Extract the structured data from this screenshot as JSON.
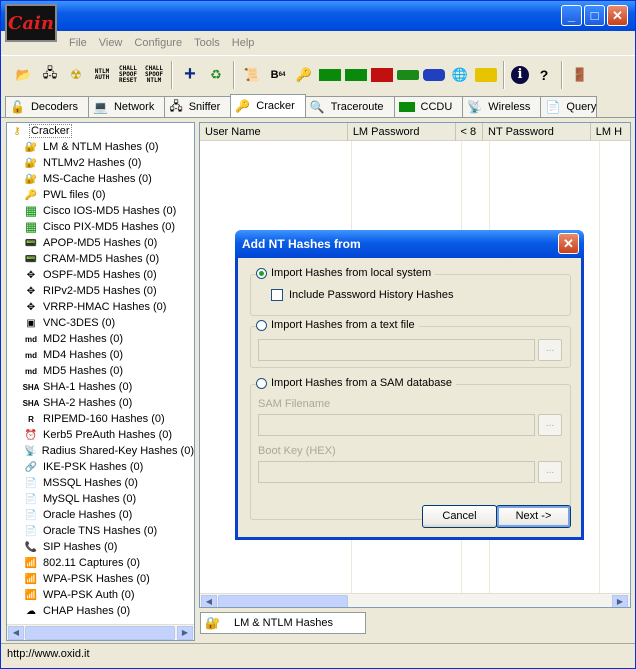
{
  "window": {
    "menu_glyph": "▪"
  },
  "menu": [
    "File",
    "View",
    "Configure",
    "Tools",
    "Help"
  ],
  "toolbar": {
    "ntlm_auth": [
      "NTLM",
      "AUTH"
    ],
    "chall_spoof_reset": [
      "CHALL",
      "SPOOF",
      "RESET"
    ],
    "chall_spoof_ntlm": [
      "CHALL",
      "SPOOF",
      "NTLM"
    ],
    "b64": "B",
    "b64_sub": "64"
  },
  "tabs": [
    {
      "label": "Decoders",
      "icon": "decoders-icon"
    },
    {
      "label": "Network",
      "icon": "network-icon"
    },
    {
      "label": "Sniffer",
      "icon": "sniffer-icon"
    },
    {
      "label": "Cracker",
      "icon": "cracker-icon"
    },
    {
      "label": "Traceroute",
      "icon": "traceroute-icon"
    },
    {
      "label": "CCDU",
      "icon": "ccdu-icon"
    },
    {
      "label": "Wireless",
      "icon": "wireless-icon"
    },
    {
      "label": "Query",
      "icon": "query-icon"
    }
  ],
  "tree": {
    "root": "Cracker",
    "items": [
      "LM & NTLM Hashes (0)",
      "NTLMv2 Hashes (0)",
      "MS-Cache Hashes (0)",
      "PWL files (0)",
      "Cisco IOS-MD5 Hashes (0)",
      "Cisco PIX-MD5 Hashes (0)",
      "APOP-MD5 Hashes (0)",
      "CRAM-MD5 Hashes (0)",
      "OSPF-MD5 Hashes (0)",
      "RIPv2-MD5 Hashes (0)",
      "VRRP-HMAC Hashes (0)",
      "VNC-3DES (0)",
      "MD2 Hashes (0)",
      "MD4 Hashes (0)",
      "MD5 Hashes (0)",
      "SHA-1 Hashes (0)",
      "SHA-2 Hashes (0)",
      "RIPEMD-160 Hashes (0)",
      "Kerb5 PreAuth Hashes (0)",
      "Radius Shared-Key Hashes (0)",
      "IKE-PSK Hashes (0)",
      "MSSQL Hashes (0)",
      "MySQL Hashes (0)",
      "Oracle Hashes (0)",
      "Oracle TNS Hashes (0)",
      "SIP Hashes (0)",
      "802.11 Captures (0)",
      "WPA-PSK Hashes (0)",
      "WPA-PSK Auth (0)",
      "CHAP Hashes (0)"
    ]
  },
  "grid": {
    "columns": [
      "User Name",
      "LM Password",
      "< 8",
      "NT Password",
      "LM H"
    ]
  },
  "bottom_tab": "LM & NTLM Hashes",
  "status": "http://www.oxid.it",
  "dialog": {
    "title": "Add NT Hashes from",
    "close_glyph": "✕",
    "opt_local": "Import Hashes from local system",
    "include_history": "Include Password History Hashes",
    "opt_text": "Import Hashes from a text file",
    "opt_sam": "Import Hashes from a SAM database",
    "sam_filename_label": "SAM Filename",
    "boot_key_label": "Boot Key (HEX)",
    "browse": "...",
    "cancel": "Cancel",
    "next": "Next ->"
  }
}
